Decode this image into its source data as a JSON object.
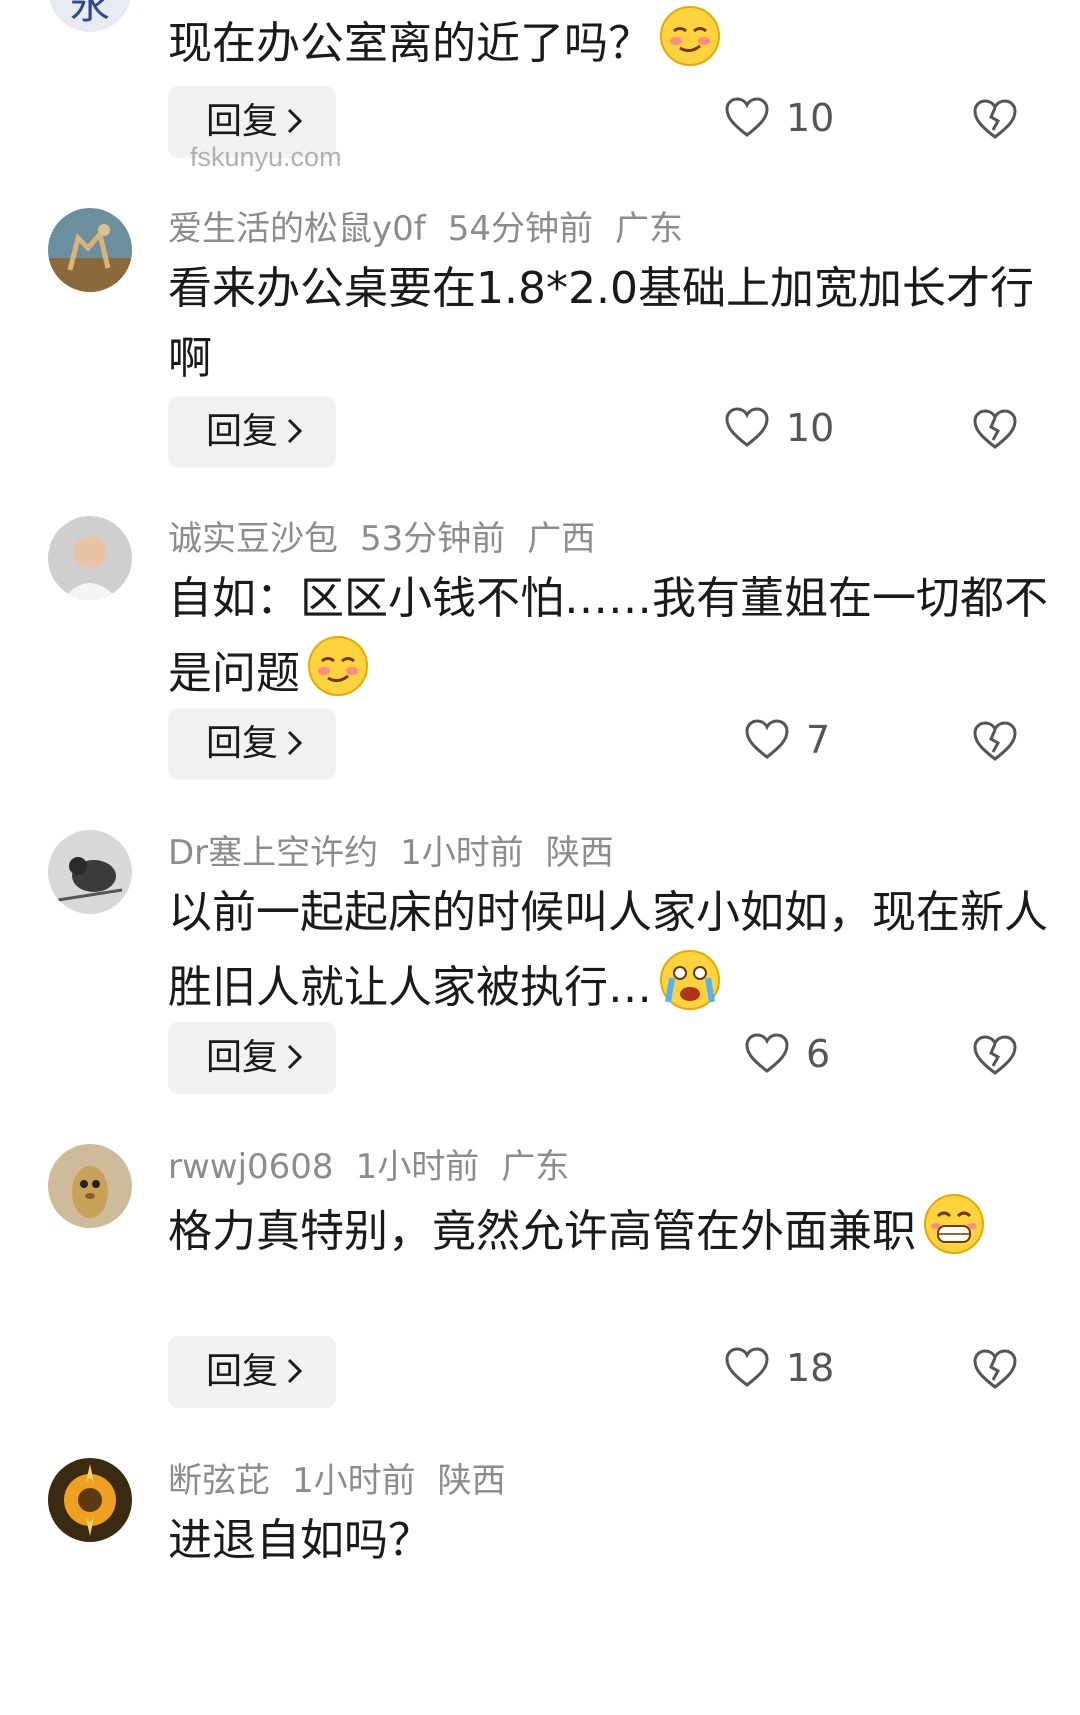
{
  "comments": [
    {
      "user": "",
      "time": "",
      "region": "",
      "text": "现在办公室离的近了吗？",
      "emoji": "smirk-emoji",
      "reply_label": "回复",
      "likes": "10"
    },
    {
      "user": "爱生活的松鼠y0f",
      "time": "54分钟前",
      "region": "广东",
      "text": "看来办公桌要在1.8*2.0基础上加宽加长才行啊",
      "emoji": "",
      "reply_label": "回复",
      "likes": "10"
    },
    {
      "user": "诚实豆沙包",
      "time": "53分钟前",
      "region": "广西",
      "text": "自如：区区小钱不怕……我有董姐在一切都不是问题",
      "emoji": "smirk-emoji",
      "reply_label": "回复",
      "likes": "7"
    },
    {
      "user": "Dr塞上空许约",
      "time": "1小时前",
      "region": "陕西",
      "text": "以前一起起床的时候叫人家小如如，现在新人胜旧人就让人家被执行…",
      "emoji": "crying-emoji",
      "reply_label": "回复",
      "likes": "6"
    },
    {
      "user": "rwwj0608",
      "time": "1小时前",
      "region": "广东",
      "text": "格力真特别，竟然允许高管在外面兼职",
      "emoji": "grin-emoji",
      "reply_label": "回复",
      "likes": "18"
    },
    {
      "user": "断弦芘",
      "time": "1小时前",
      "region": "陕西",
      "text": "进退自如吗？",
      "emoji": "",
      "reply_label": "",
      "likes": ""
    }
  ],
  "watermark": "fskunyu.com",
  "colors": {
    "meta_text": "#8c8c8c",
    "body_text": "#1a1a1a",
    "reply_bg": "#f2f2f2",
    "icon_stroke": "#555555"
  }
}
